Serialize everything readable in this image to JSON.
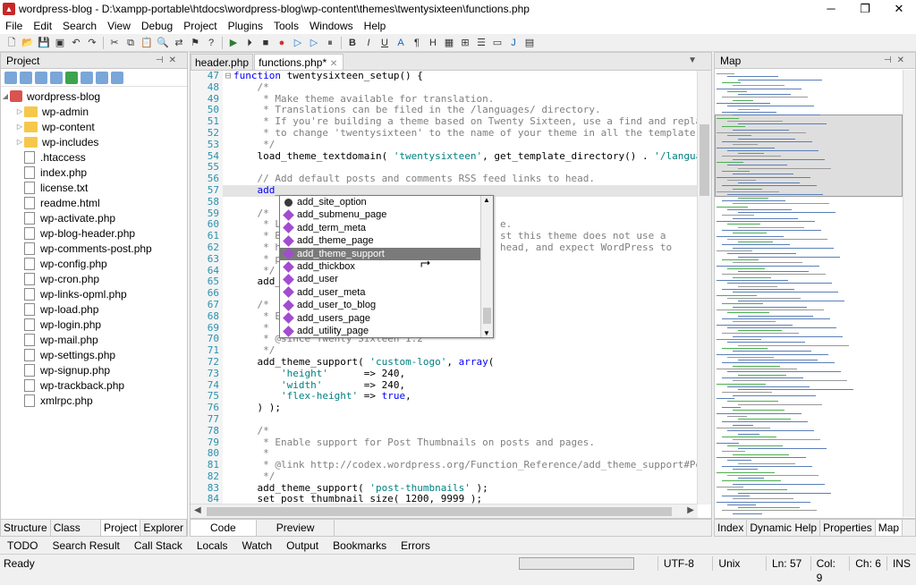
{
  "window": {
    "title": "wordpress-blog - D:\\xampp-portable\\htdocs\\wordpress-blog\\wp-content\\themes\\twentysixteen\\functions.php",
    "controls": [
      "minimize-icon",
      "restore-icon",
      "close-icon"
    ]
  },
  "menu": [
    "File",
    "Edit",
    "Search",
    "View",
    "Debug",
    "Project",
    "Plugins",
    "Tools",
    "Windows",
    "Help"
  ],
  "project_panel": {
    "title": "Project",
    "root": "wordpress-blog",
    "folders": [
      "wp-admin",
      "wp-content",
      "wp-includes"
    ],
    "files": [
      ".htaccess",
      "index.php",
      "license.txt",
      "readme.html",
      "wp-activate.php",
      "wp-blog-header.php",
      "wp-comments-post.php",
      "wp-config.php",
      "wp-cron.php",
      "wp-links-opml.php",
      "wp-load.php",
      "wp-login.php",
      "wp-mail.php",
      "wp-settings.php",
      "wp-signup.php",
      "wp-trackback.php",
      "xmlrpc.php"
    ]
  },
  "left_tabs": [
    "Structure",
    "Class View",
    "Project",
    "Explorer"
  ],
  "editor": {
    "tabs": [
      {
        "label": "header.php",
        "active": false
      },
      {
        "label": "functions.php*",
        "active": true
      }
    ],
    "lines": [
      {
        "n": "47",
        "fold": "⊟",
        "segments": [
          {
            "c": "kw",
            "t": "function "
          },
          {
            "c": "tx",
            "t": "twentysixteen_setup() {"
          }
        ]
      },
      {
        "n": "48",
        "fold": "",
        "segments": [
          {
            "c": "cm",
            "t": "    /*"
          }
        ]
      },
      {
        "n": "49",
        "fold": "",
        "segments": [
          {
            "c": "cm",
            "t": "     * Make theme available for translation."
          }
        ]
      },
      {
        "n": "50",
        "fold": "",
        "segments": [
          {
            "c": "cm",
            "t": "     * Translations can be filed in the /languages/ directory."
          }
        ]
      },
      {
        "n": "51",
        "fold": "",
        "segments": [
          {
            "c": "cm",
            "t": "     * If you're building a theme based on Twenty Sixteen, use a find and replace"
          }
        ]
      },
      {
        "n": "52",
        "fold": "",
        "segments": [
          {
            "c": "cm",
            "t": "     * to change 'twentysixteen' to the name of your theme in all the template fi"
          }
        ]
      },
      {
        "n": "53",
        "fold": "",
        "segments": [
          {
            "c": "cm",
            "t": "     */"
          }
        ]
      },
      {
        "n": "54",
        "fold": "",
        "segments": [
          {
            "c": "tx",
            "t": "    load_theme_textdomain( "
          },
          {
            "c": "st",
            "t": "'twentysixteen'"
          },
          {
            "c": "tx",
            "t": ", get_template_directory() . "
          },
          {
            "c": "st",
            "t": "'/language"
          }
        ]
      },
      {
        "n": "55",
        "fold": "",
        "segments": [
          {
            "c": "tx",
            "t": ""
          }
        ]
      },
      {
        "n": "56",
        "fold": "",
        "segments": [
          {
            "c": "cm",
            "t": "    // Add default posts and comments RSS feed links to head."
          }
        ]
      },
      {
        "n": "57",
        "fold": "",
        "hl": true,
        "segments": [
          {
            "c": "kw",
            "t": "    add_"
          }
        ]
      },
      {
        "n": "58",
        "fold": "",
        "segments": [
          {
            "c": "tx",
            "t": ""
          }
        ]
      },
      {
        "n": "59",
        "fold": "",
        "segments": [
          {
            "c": "cm",
            "t": "    /*"
          }
        ]
      },
      {
        "n": "60",
        "fold": "",
        "segments": [
          {
            "c": "cm",
            "t": "     * L                                     e."
          }
        ]
      },
      {
        "n": "61",
        "fold": "",
        "segments": [
          {
            "c": "cm",
            "t": "     * B                                     st this theme does not use a"
          }
        ]
      },
      {
        "n": "62",
        "fold": "",
        "segments": [
          {
            "c": "cm",
            "t": "     * h                                     head, and expect WordPress to"
          }
        ]
      },
      {
        "n": "63",
        "fold": "",
        "segments": [
          {
            "c": "cm",
            "t": "     * p"
          }
        ]
      },
      {
        "n": "64",
        "fold": "",
        "segments": [
          {
            "c": "cm",
            "t": "     */"
          }
        ]
      },
      {
        "n": "65",
        "fold": "",
        "segments": [
          {
            "c": "tx",
            "t": "    add_"
          }
        ]
      },
      {
        "n": "66",
        "fold": "",
        "segments": [
          {
            "c": "tx",
            "t": ""
          }
        ]
      },
      {
        "n": "67",
        "fold": "",
        "segments": [
          {
            "c": "cm",
            "t": "    /*"
          }
        ]
      },
      {
        "n": "68",
        "fold": "",
        "segments": [
          {
            "c": "cm",
            "t": "     * E"
          }
        ]
      },
      {
        "n": "69",
        "fold": "",
        "segments": [
          {
            "c": "cm",
            "t": "     *"
          }
        ]
      },
      {
        "n": "70",
        "fold": "",
        "segments": [
          {
            "c": "cm",
            "t": "     * @since Twenty Sixteen 1.2"
          }
        ]
      },
      {
        "n": "71",
        "fold": "",
        "segments": [
          {
            "c": "cm",
            "t": "     */"
          }
        ]
      },
      {
        "n": "72",
        "fold": "",
        "segments": [
          {
            "c": "tx",
            "t": "    add_theme_support( "
          },
          {
            "c": "st",
            "t": "'custom-logo'"
          },
          {
            "c": "tx",
            "t": ", "
          },
          {
            "c": "kw",
            "t": "array"
          },
          {
            "c": "tx",
            "t": "("
          }
        ]
      },
      {
        "n": "73",
        "fold": "",
        "segments": [
          {
            "c": "st",
            "t": "        'height'"
          },
          {
            "c": "tx",
            "t": "      => 240,"
          }
        ]
      },
      {
        "n": "74",
        "fold": "",
        "segments": [
          {
            "c": "st",
            "t": "        'width'"
          },
          {
            "c": "tx",
            "t": "       => 240,"
          }
        ]
      },
      {
        "n": "75",
        "fold": "",
        "segments": [
          {
            "c": "st",
            "t": "        'flex-height'"
          },
          {
            "c": "tx",
            "t": " => "
          },
          {
            "c": "kw",
            "t": "true"
          },
          {
            "c": "tx",
            "t": ","
          }
        ]
      },
      {
        "n": "76",
        "fold": "",
        "segments": [
          {
            "c": "tx",
            "t": "    ) );"
          }
        ]
      },
      {
        "n": "77",
        "fold": "",
        "segments": [
          {
            "c": "tx",
            "t": ""
          }
        ]
      },
      {
        "n": "78",
        "fold": "",
        "segments": [
          {
            "c": "cm",
            "t": "    /*"
          }
        ]
      },
      {
        "n": "79",
        "fold": "",
        "segments": [
          {
            "c": "cm",
            "t": "     * Enable support for Post Thumbnails on posts and pages."
          }
        ]
      },
      {
        "n": "80",
        "fold": "",
        "segments": [
          {
            "c": "cm",
            "t": "     *"
          }
        ]
      },
      {
        "n": "81",
        "fold": "",
        "segments": [
          {
            "c": "cm",
            "t": "     * @link http://codex.wordpress.org/Function_Reference/add_theme_support#Post"
          }
        ]
      },
      {
        "n": "82",
        "fold": "",
        "segments": [
          {
            "c": "cm",
            "t": "     */"
          }
        ]
      },
      {
        "n": "83",
        "fold": "",
        "segments": [
          {
            "c": "tx",
            "t": "    add_theme_support( "
          },
          {
            "c": "st",
            "t": "'post-thumbnails'"
          },
          {
            "c": "tx",
            "t": " );"
          }
        ]
      },
      {
        "n": "84",
        "fold": "",
        "segments": [
          {
            "c": "tx",
            "t": "    set_post_thumbnail_size( 1200, 9999 );"
          }
        ]
      }
    ]
  },
  "autocomplete": {
    "items": [
      {
        "label": "add_site_option",
        "icon": "wp-icon",
        "selected": false
      },
      {
        "label": "add_submenu_page",
        "icon": "function-icon",
        "selected": false
      },
      {
        "label": "add_term_meta",
        "icon": "function-icon",
        "selected": false
      },
      {
        "label": "add_theme_page",
        "icon": "function-icon",
        "selected": false
      },
      {
        "label": "add_theme_support",
        "icon": "function-icon",
        "selected": true
      },
      {
        "label": "add_thickbox",
        "icon": "function-icon",
        "selected": false
      },
      {
        "label": "add_user",
        "icon": "function-icon",
        "selected": false
      },
      {
        "label": "add_user_meta",
        "icon": "function-icon",
        "selected": false
      },
      {
        "label": "add_user_to_blog",
        "icon": "function-icon",
        "selected": false
      },
      {
        "label": "add_users_page",
        "icon": "function-icon",
        "selected": false
      },
      {
        "label": "add_utility_page",
        "icon": "function-icon",
        "selected": false
      }
    ]
  },
  "editor_bottom_tabs": [
    "Code",
    "Preview"
  ],
  "map_panel": {
    "title": "Map"
  },
  "right_tabs": [
    "Index",
    "Dynamic Help",
    "Properties",
    "Map"
  ],
  "tool_tabs": [
    "TODO",
    "Search Result",
    "Call Stack",
    "Locals",
    "Watch",
    "Output",
    "Bookmarks",
    "Errors"
  ],
  "status": {
    "state": "Ready",
    "encoding": "UTF-8",
    "line_endings": "Unix",
    "line": "Ln: 57",
    "col": "Col: 9",
    "ch": "Ch: 6",
    "mode": "INS"
  },
  "colors": {
    "keyword": "#0000ff",
    "comment": "#808080",
    "string": "#008080",
    "line_number": "#2b91af",
    "selection": "#7a7a7a"
  }
}
